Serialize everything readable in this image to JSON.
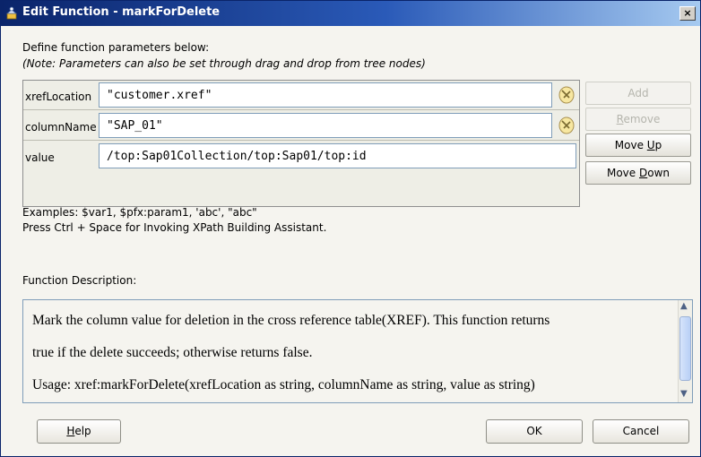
{
  "window": {
    "title": "Edit Function - markForDelete",
    "close_glyph": "×",
    "icon": "function-wizard-icon"
  },
  "intro": {
    "line1": "Define function parameters below:",
    "line2": "(Note: Parameters can also be set through drag and drop from tree nodes)"
  },
  "parameters": [
    {
      "name": "xrefLocation",
      "value": "\"customer.xref\""
    },
    {
      "name": "columnName",
      "value": "\"SAP_01\""
    },
    {
      "name": "value",
      "value": "/top:Sap01Collection/top:Sap01/top:id"
    }
  ],
  "side_buttons": {
    "add": {
      "label": "Add",
      "enabled": false
    },
    "remove": {
      "pre": "",
      "mnemonic": "R",
      "post": "emove",
      "enabled": false
    },
    "move_up": {
      "pre": "Move ",
      "mnemonic": "U",
      "post": "p",
      "enabled": true
    },
    "move_down": {
      "pre": "Move ",
      "mnemonic": "D",
      "post": "own",
      "enabled": true
    }
  },
  "hints": {
    "examples": "Examples: $var1, $pfx:param1, 'abc', \"abc\"",
    "assistant": "Press Ctrl + Space for Invoking XPath Building Assistant."
  },
  "description": {
    "label": "Function Description:",
    "lines": [
      "Mark the column value for deletion in the cross reference table(XREF). This function returns",
      "true if the delete succeeds; otherwise returns false.",
      "Usage: xref:markForDelete(xrefLocation as string, columnName as string, value as string)"
    ]
  },
  "footer": {
    "help": {
      "mnemonic": "H",
      "post": "elp"
    },
    "ok": "OK",
    "cancel": "Cancel"
  },
  "colors": {
    "title_bar_start": "#0a246a",
    "title_bar_end": "#a6caf0",
    "dialog_bg": "#f5f4ef",
    "disabled_text": "#b5b5ad"
  }
}
